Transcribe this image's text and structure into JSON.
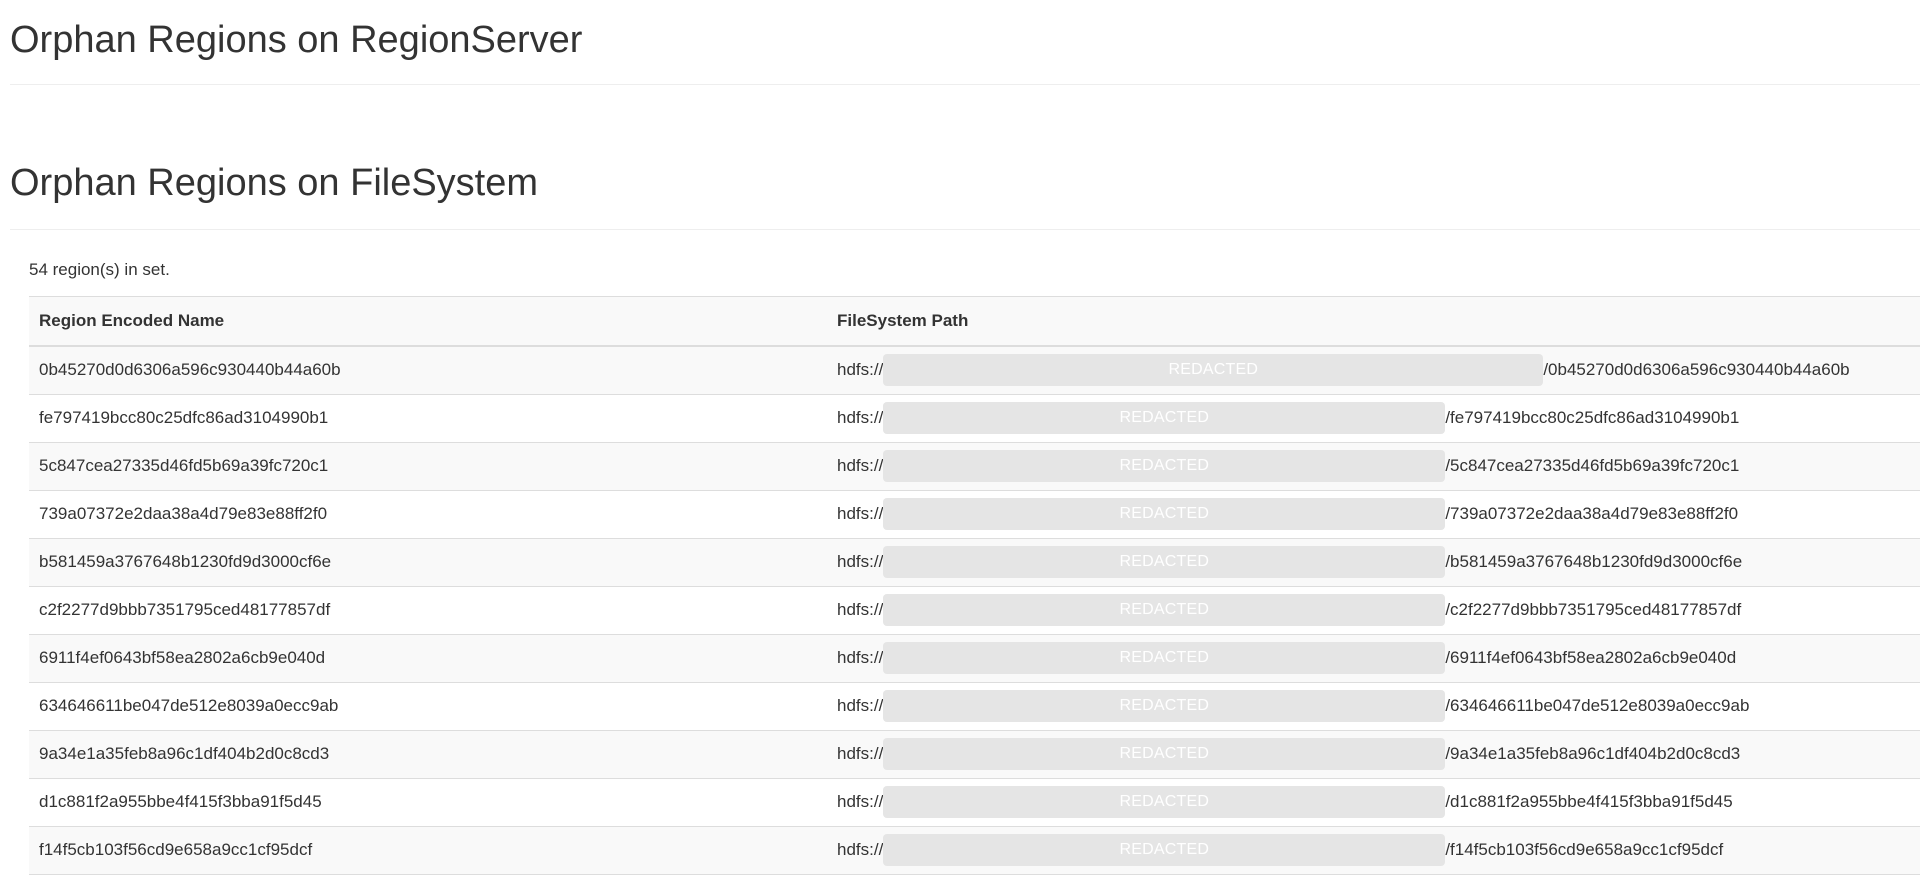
{
  "regionserver_section": {
    "title": "Orphan Regions on RegionServer"
  },
  "filesystem_section": {
    "title": "Orphan Regions on FileSystem",
    "count_text": "54 region(s) in set.",
    "columns": [
      "Region Encoded Name",
      "FileSystem Path"
    ],
    "rows": [
      {
        "name": "0b45270d0d6306a596c930440b44a60b",
        "prefix": "hdfs://",
        "redacted": "REDACTED",
        "suffix": "/0b45270d0d6306a596c930440b44a60b"
      },
      {
        "name": "fe797419bcc80c25dfc86ad3104990b1",
        "prefix": "hdfs://",
        "redacted": "REDACTED",
        "suffix": "/fe797419bcc80c25dfc86ad3104990b1"
      },
      {
        "name": "5c847cea27335d46fd5b69a39fc720c1",
        "prefix": "hdfs://",
        "redacted": "REDACTED",
        "suffix": "/5c847cea27335d46fd5b69a39fc720c1"
      },
      {
        "name": "739a07372e2daa38a4d79e83e88ff2f0",
        "prefix": "hdfs://",
        "redacted": "REDACTED",
        "suffix": "/739a07372e2daa38a4d79e83e88ff2f0"
      },
      {
        "name": "b581459a3767648b1230fd9d3000cf6e",
        "prefix": "hdfs://",
        "redacted": "REDACTED",
        "suffix": "/b581459a3767648b1230fd9d3000cf6e"
      },
      {
        "name": "c2f2277d9bbb7351795ced48177857df",
        "prefix": "hdfs://",
        "redacted": "REDACTED",
        "suffix": "/c2f2277d9bbb7351795ced48177857df"
      },
      {
        "name": "6911f4ef0643bf58ea2802a6cb9e040d",
        "prefix": "hdfs://",
        "redacted": "REDACTED",
        "suffix": "/6911f4ef0643bf58ea2802a6cb9e040d"
      },
      {
        "name": "634646611be047de512e8039a0ecc9ab",
        "prefix": "hdfs://",
        "redacted": "REDACTED",
        "suffix": "/634646611be047de512e8039a0ecc9ab"
      },
      {
        "name": "9a34e1a35feb8a96c1df404b2d0c8cd3",
        "prefix": "hdfs://",
        "redacted": "REDACTED",
        "suffix": "/9a34e1a35feb8a96c1df404b2d0c8cd3"
      },
      {
        "name": "d1c881f2a955bbe4f415f3bba91f5d45",
        "prefix": "hdfs://",
        "redacted": "REDACTED",
        "suffix": "/d1c881f2a955bbe4f415f3bba91f5d45"
      },
      {
        "name": "f14f5cb103f56cd9e658a9cc1cf95dcf",
        "prefix": "hdfs://",
        "redacted": "REDACTED",
        "suffix": "/f14f5cb103f56cd9e658a9cc1cf95dcf"
      }
    ]
  },
  "colors": {
    "text": "#333333",
    "border": "#dddddd",
    "stripe": "#f9f9f9",
    "redaction": "#e5e5e5"
  }
}
